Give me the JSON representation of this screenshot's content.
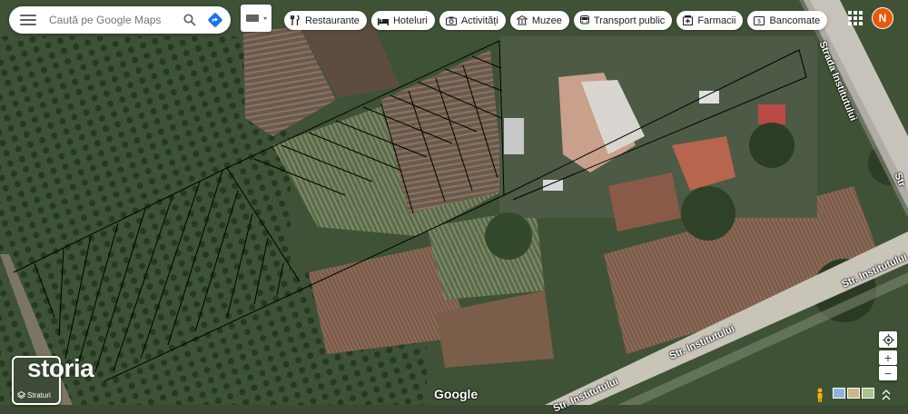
{
  "search": {
    "placeholder": "Caută pe Google Maps"
  },
  "chips": [
    {
      "icon": "fork-knife-icon",
      "label": "Restaurante"
    },
    {
      "icon": "bed-icon",
      "label": "Hoteluri"
    },
    {
      "icon": "camera-icon",
      "label": "Activități"
    },
    {
      "icon": "museum-icon",
      "label": "Muzee"
    },
    {
      "icon": "bus-icon",
      "label": "Transport public"
    },
    {
      "icon": "pharmacy-icon",
      "label": "Farmacii"
    },
    {
      "icon": "atm-icon",
      "label": "Bancomate"
    }
  ],
  "account": {
    "initial": "N",
    "color": "#e8590c"
  },
  "roads": {
    "vertical": "Strada Institutului",
    "vertical_cut": "Str",
    "diagonal_1": "Str. Institutului",
    "diagonal_2": "Str. Institutului",
    "diagonal_3": "Str. Institutului"
  },
  "layers": {
    "label": "Straturi"
  },
  "watermark": "storia",
  "attribution": "Google",
  "controls": {
    "zoom_in": "+",
    "zoom_out": "−"
  },
  "colors": {
    "hatch_line": "#000000",
    "ui_bg": "#ffffff",
    "accent_blue": "#1a73e8"
  }
}
